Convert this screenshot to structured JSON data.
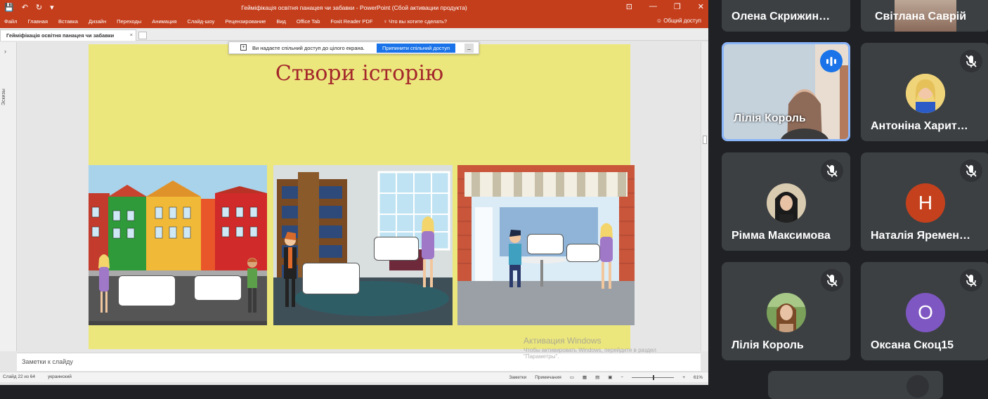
{
  "ppt": {
    "qat": [
      "💾",
      "↶",
      "↻",
      "▾"
    ],
    "window_title": "Гейміфікація освітня панацея чи забавки - PowerPoint (Сбой активации продукта)",
    "window_buttons": [
      "⊡",
      "—",
      "❐",
      "✕"
    ],
    "ribbon_tabs": [
      "Файл",
      "Главная",
      "Вставка",
      "Дизайн",
      "Переходы",
      "Анимация",
      "Слайд-шоу",
      "Рецензирование",
      "Вид",
      "Office Tab",
      "Foxit Reader PDF",
      "♀ Что вы хотите сделать?"
    ],
    "share_button": "Общий доступ",
    "doc_tab": "Гейміфікація освітня панацея чи забавки",
    "doc_tab_close": "×",
    "side_label": "Эскизы",
    "share_notice": "Ви надаєте спільний доступ до цілого екрана.",
    "share_accept": "Припинити спільний доступ",
    "slide_title": "Створи історію",
    "notes": "Заметки к слайду",
    "status_left": [
      "Слайд 22 из 64",
      "украинский"
    ],
    "status_right": [
      "Заметки",
      "Примечания",
      "61%"
    ],
    "activation_title": "Активация Windows",
    "activation_sub": "Чтобы активировать Windows, перейдите в раздел \"Параметры\"."
  },
  "participants": [
    {
      "name": "Олена Скрижин…"
    },
    {
      "name": "Світлана Саврій"
    },
    {
      "name": "Лілія Король",
      "speaking": true
    },
    {
      "name": "Антоніна Харит…",
      "muted": true
    },
    {
      "name": "Рімма Максимова",
      "muted": true
    },
    {
      "name": "Наталія Яремен…",
      "muted": true,
      "initial": "Н"
    },
    {
      "name": "Лілія Король",
      "muted": true
    },
    {
      "name": "Оксана Скоц15",
      "muted": true,
      "initial": "О"
    }
  ],
  "colors": {
    "ppt_accent": "#c43e1c",
    "slide_bg": "#ece77d",
    "title_red": "#a3262b",
    "meet_tile": "#3c4043",
    "active_border": "#8ab4f8",
    "avatar_n": "#c5411d",
    "avatar_o": "#7e57c2"
  }
}
